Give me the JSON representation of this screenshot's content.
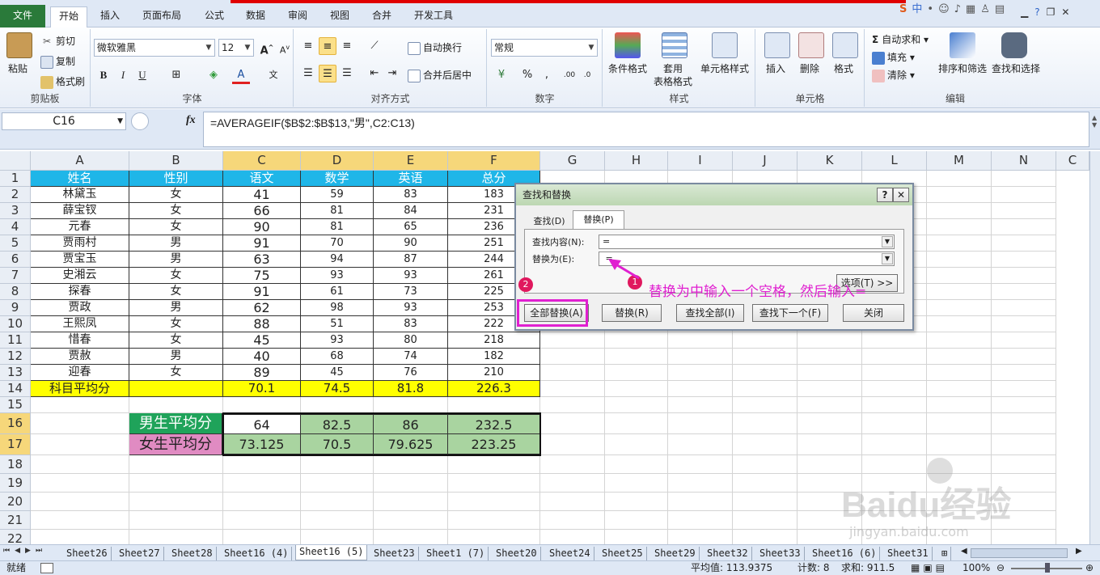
{
  "tabs": [
    "文件",
    "开始",
    "插入",
    "页面布局",
    "公式",
    "数据",
    "审阅",
    "视图",
    "合并",
    "开发工具"
  ],
  "ribbon": {
    "clipboard": {
      "paste": "粘贴",
      "cut": "剪切",
      "copy": "复制",
      "format_painter": "格式刷",
      "label": "剪贴板"
    },
    "font": {
      "name": "微软雅黑",
      "size": "12",
      "label": "字体"
    },
    "align": {
      "wrap": "自动换行",
      "merge": "合并后居中",
      "label": "对齐方式"
    },
    "number": {
      "format": "常规",
      "label": "数字"
    },
    "styles": {
      "cond": "条件格式",
      "table1": "套用",
      "table2": "表格格式",
      "cell": "单元格样式",
      "label": "样式"
    },
    "cells": {
      "insert": "插入",
      "delete": "删除",
      "format": "格式",
      "label": "单元格"
    },
    "editing": {
      "autosum": "自动求和",
      "fill": "填充",
      "clear": "清除",
      "sort": "排序和筛选",
      "find": "查找和选择",
      "label": "编辑"
    }
  },
  "namebox": "C16",
  "formula": "=AVERAGEIF($B$2:$B$13,\"男\",C2:C13)",
  "columns": [
    "A",
    "B",
    "C",
    "D",
    "E",
    "F",
    "G",
    "H",
    "I",
    "J",
    "K",
    "L",
    "M",
    "N",
    "C"
  ],
  "rows": [
    "1",
    "2",
    "3",
    "4",
    "5",
    "6",
    "7",
    "8",
    "9",
    "10",
    "11",
    "12",
    "13",
    "14",
    "15",
    "16",
    "17",
    "18",
    "19",
    "20",
    "21",
    "22"
  ],
  "headers": [
    "姓名",
    "性别",
    "语文",
    "数学",
    "英语",
    "总分"
  ],
  "data": [
    [
      "林黛玉",
      "女",
      "41",
      "59",
      "83",
      "183"
    ],
    [
      "薛宝钗",
      "女",
      "66",
      "81",
      "84",
      "231"
    ],
    [
      "元春",
      "女",
      "90",
      "81",
      "65",
      "236"
    ],
    [
      "贾雨村",
      "男",
      "91",
      "70",
      "90",
      "251"
    ],
    [
      "贾宝玉",
      "男",
      "63",
      "94",
      "87",
      "244"
    ],
    [
      "史湘云",
      "女",
      "75",
      "93",
      "93",
      "261"
    ],
    [
      "探春",
      "女",
      "91",
      "61",
      "73",
      "225"
    ],
    [
      "贾政",
      "男",
      "62",
      "98",
      "93",
      "253"
    ],
    [
      "王熙凤",
      "女",
      "88",
      "51",
      "83",
      "222"
    ],
    [
      "惜春",
      "女",
      "45",
      "93",
      "80",
      "218"
    ],
    [
      "贾赦",
      "男",
      "40",
      "68",
      "74",
      "182"
    ],
    [
      "迎春",
      "女",
      "89",
      "45",
      "76",
      "210"
    ]
  ],
  "avg_row": [
    "科目平均分",
    "",
    "70.1",
    "74.5",
    "81.8",
    "226.3"
  ],
  "male_avg": {
    "label": "男生平均分",
    "values": [
      "64",
      "82.5",
      "86",
      "232.5"
    ]
  },
  "female_avg": {
    "label": "女生平均分",
    "values": [
      "73.125",
      "70.5",
      "79.625",
      "223.25"
    ]
  },
  "dialog": {
    "title": "查找和替换",
    "tab_find": "查找(D)",
    "tab_replace": "替换(P)",
    "find_label": "查找内容(N):",
    "find_value": "=",
    "replace_label": "替换为(E):",
    "replace_value": " =",
    "options": "选项(T) >>",
    "replace_all": "全部替换(A)",
    "replace": "替换(R)",
    "find_all": "查找全部(I)",
    "find_next": "查找下一个(F)",
    "close": "关闭",
    "help": "?",
    "x": "✕"
  },
  "annotation": {
    "badge1": "1",
    "badge2": "2",
    "note": "替换为中输入一个空格，然后输入="
  },
  "sheets": [
    "Sheet26",
    "Sheet27",
    "Sheet28",
    "Sheet16 (4)",
    "Sheet16 (5)",
    "Sheet23",
    "Sheet1 (7)",
    "Sheet20",
    "Sheet24",
    "Sheet25",
    "Sheet29",
    "Sheet32",
    "Sheet33",
    "Sheet16 (6)",
    "Sheet31"
  ],
  "status": {
    "ready": "就绪",
    "average": "平均值: 113.9375",
    "count": "计数: 8",
    "sum": "求和: 911.5",
    "zoom": "100%"
  },
  "watermark": {
    "logo": "Baidu经验",
    "url": "jingyan.baidu.com"
  },
  "colors": {
    "header_blue": "#1fb6e8",
    "avg_yellow": "#ffff00",
    "male_green": "#1fa35a",
    "female_pink": "#e08bc2",
    "result_green": "#a9d4a0",
    "accent_magenta": "#e020d0"
  }
}
